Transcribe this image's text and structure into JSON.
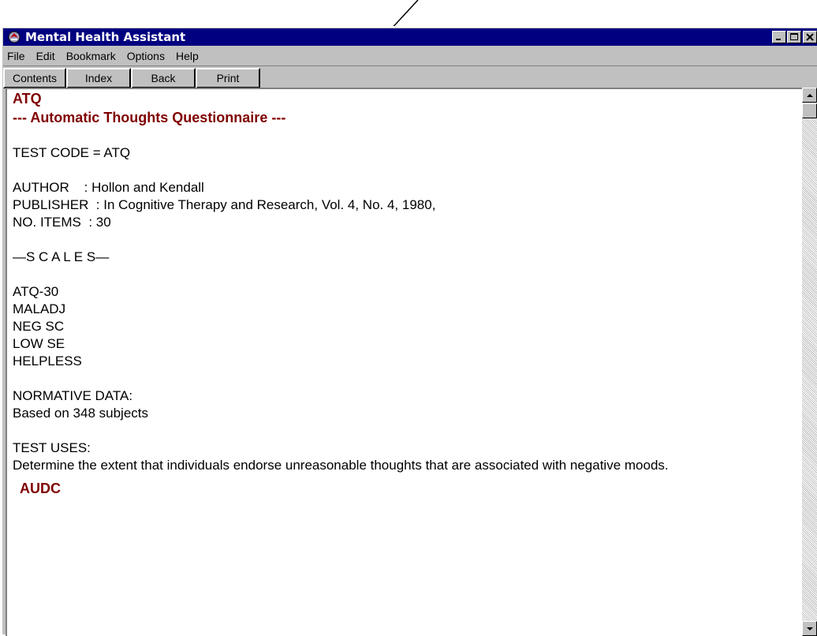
{
  "window": {
    "title": "Mental Health Assistant",
    "controls": [
      "minimize-icon",
      "maximize-icon",
      "close-icon"
    ]
  },
  "menu": {
    "file": "File",
    "edit": "Edit",
    "bookmark": "Bookmark",
    "options": "Options",
    "help": "Help"
  },
  "toolbar": {
    "contents": "Contents",
    "index": "Index",
    "back": "Back",
    "print": "Print"
  },
  "document": {
    "code_heading": "ATQ",
    "title_heading": "--- Automatic Thoughts Questionnaire ---",
    "test_code": "TEST CODE = ATQ",
    "author": "AUTHOR    : Hollon and Kendall",
    "publisher": "PUBLISHER  : In Cognitive Therapy and Research, Vol. 4, No. 4, 1980,",
    "items": "NO. ITEMS  : 30",
    "scales_heading": "—S C A L E S—",
    "scales": [
      "ATQ-30",
      "MALADJ",
      "NEG SC",
      "LOW SE",
      "HELPLESS"
    ],
    "normative_label": "NORMATIVE DATA:",
    "normative_value": "Based on 348 subjects",
    "uses_label": "TEST USES:",
    "uses_value": "Determine the extent that individuals endorse unreasonable thoughts that are associated with negative moods.",
    "next_heading": "AUDC"
  },
  "colors": {
    "titlebar": "#000080",
    "heading": "#800000",
    "chrome": "#c0c0c0"
  }
}
